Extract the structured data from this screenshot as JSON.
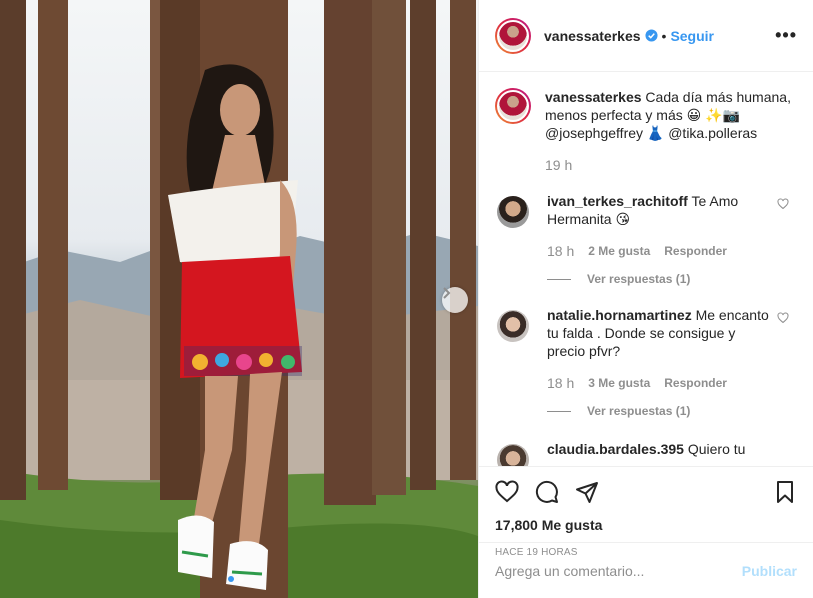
{
  "header": {
    "username": "vanessaterkes",
    "separator": "•",
    "follow_label": "Seguir",
    "more_label": "•••"
  },
  "caption": {
    "username": "vanessaterkes",
    "text": "Cada día más humana, menos perfecta y más 😀 ✨📷 @josephgeffrey 👗 @tika.polleras",
    "time": "19 h"
  },
  "comments": [
    {
      "username": "ivan_terkes_rachitoff",
      "text": "Te Amo Hermanita 😘",
      "time": "18 h",
      "likes": "2 Me gusta",
      "reply": "Responder",
      "view_replies": "Ver respuestas (1)"
    },
    {
      "username": "natalie.hornamartinez",
      "text": "Me encanto tu falda . Donde se consigue y precio pfvr?",
      "time": "18 h",
      "likes": "3 Me gusta",
      "reply": "Responder",
      "view_replies": "Ver respuestas (1)"
    },
    {
      "username": "claudia.bardales.395",
      "text": "Quiero tu"
    }
  ],
  "footer": {
    "likes_count": "17,800 Me gusta",
    "posted_ago": "HACE 19 HORAS",
    "comment_placeholder": "Agrega un comentario...",
    "publish_label": "Publicar"
  },
  "colors": {
    "link_blue": "#3897f0",
    "publish_disabled": "#b2dffc",
    "muted_text": "#8e8e8e",
    "skirt_red": "#d4161f"
  },
  "carousel": {
    "current_slide": 1,
    "total_slides": 2
  }
}
